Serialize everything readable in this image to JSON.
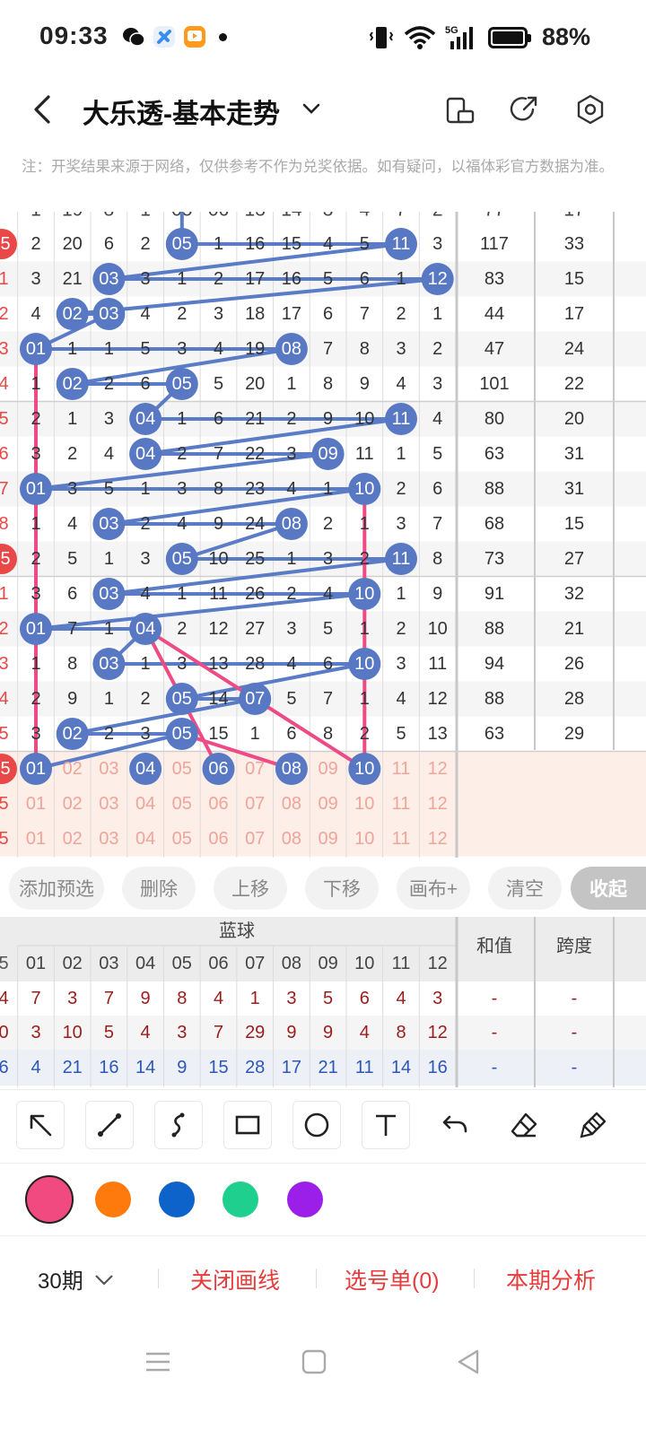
{
  "status_bar": {
    "time": "09:33",
    "battery": "88%",
    "network": "5G"
  },
  "header": {
    "title": "大乐透-基本走势"
  },
  "notice": "注：开奖结果来源于网络，仅供参考不作为兑奖依据。如有疑问，以福体彩官方数据为准。",
  "grid": {
    "partial_top_row": [
      "1",
      "19",
      "8",
      "1",
      "05",
      "06",
      "13",
      "14",
      "3",
      "4",
      "7",
      "2",
      "77",
      "17"
    ],
    "left_edge_numbers": [
      "5",
      "1",
      "2",
      "3",
      "4",
      "5",
      "6",
      "7",
      "8",
      "5",
      "1",
      "2",
      "3",
      "4",
      "5",
      "5",
      "5",
      "5"
    ],
    "rows": [
      {
        "cells": [
          "2",
          "20",
          "6",
          "2",
          "05",
          "1",
          "16",
          "15",
          "4",
          "5",
          "11",
          "3"
        ],
        "hit": [
          4,
          10
        ],
        "sum": "117",
        "span": "33"
      },
      {
        "cells": [
          "3",
          "21",
          "03",
          "3",
          "1",
          "2",
          "17",
          "16",
          "5",
          "6",
          "1",
          "12"
        ],
        "hit": [
          2,
          11
        ],
        "sum": "83",
        "span": "15"
      },
      {
        "cells": [
          "4",
          "02",
          "03",
          "4",
          "2",
          "3",
          "18",
          "17",
          "6",
          "7",
          "2",
          "1"
        ],
        "hit": [
          1,
          2
        ],
        "sum": "44",
        "span": "17"
      },
      {
        "cells": [
          "01",
          "1",
          "1",
          "5",
          "3",
          "4",
          "19",
          "08",
          "7",
          "8",
          "3",
          "2"
        ],
        "hit": [
          0,
          7
        ],
        "sum": "47",
        "span": "24"
      },
      {
        "cells": [
          "1",
          "02",
          "2",
          "6",
          "05",
          "5",
          "20",
          "1",
          "8",
          "9",
          "4",
          "3"
        ],
        "hit": [
          1,
          4
        ],
        "sum": "101",
        "span": "22"
      },
      {
        "cells": [
          "2",
          "1",
          "3",
          "04",
          "1",
          "6",
          "21",
          "2",
          "9",
          "10",
          "11",
          "4"
        ],
        "hit": [
          3,
          10
        ],
        "sum": "80",
        "span": "20"
      },
      {
        "cells": [
          "3",
          "2",
          "4",
          "04",
          "2",
          "7",
          "22",
          "3",
          "09",
          "11",
          "1",
          "5"
        ],
        "hit": [
          3,
          8
        ],
        "sum": "63",
        "span": "31"
      },
      {
        "cells": [
          "01",
          "3",
          "5",
          "1",
          "3",
          "8",
          "23",
          "4",
          "1",
          "10",
          "2",
          "6"
        ],
        "hit": [
          0,
          9
        ],
        "sum": "88",
        "span": "31"
      },
      {
        "cells": [
          "1",
          "4",
          "03",
          "2",
          "4",
          "9",
          "24",
          "08",
          "2",
          "1",
          "3",
          "7"
        ],
        "hit": [
          2,
          7
        ],
        "sum": "68",
        "span": "15"
      },
      {
        "cells": [
          "2",
          "5",
          "1",
          "3",
          "05",
          "10",
          "25",
          "1",
          "3",
          "2",
          "11",
          "8"
        ],
        "hit": [
          4,
          10
        ],
        "sum": "73",
        "span": "27"
      },
      {
        "cells": [
          "3",
          "6",
          "03",
          "4",
          "1",
          "11",
          "26",
          "2",
          "4",
          "10",
          "1",
          "9"
        ],
        "hit": [
          2,
          9
        ],
        "sum": "91",
        "span": "32"
      },
      {
        "cells": [
          "01",
          "7",
          "1",
          "04",
          "2",
          "12",
          "27",
          "3",
          "5",
          "1",
          "2",
          "10"
        ],
        "hit": [
          0,
          3
        ],
        "sum": "88",
        "span": "21"
      },
      {
        "cells": [
          "1",
          "8",
          "03",
          "1",
          "3",
          "13",
          "28",
          "4",
          "6",
          "10",
          "3",
          "11"
        ],
        "hit": [
          2,
          9
        ],
        "sum": "94",
        "span": "26"
      },
      {
        "cells": [
          "2",
          "9",
          "1",
          "2",
          "05",
          "14",
          "07",
          "5",
          "7",
          "1",
          "4",
          "12"
        ],
        "hit": [
          4,
          6
        ],
        "sum": "88",
        "span": "28"
      },
      {
        "cells": [
          "3",
          "02",
          "2",
          "3",
          "05",
          "15",
          "1",
          "6",
          "8",
          "2",
          "5",
          "13"
        ],
        "hit": [
          1,
          4
        ],
        "sum": "63",
        "span": "29"
      }
    ],
    "preselect_rows": [
      {
        "cells": [
          "01",
          "02",
          "03",
          "04",
          "05",
          "06",
          "07",
          "08",
          "09",
          "10",
          "11",
          "12"
        ],
        "hit": [
          0,
          3,
          5,
          7,
          9
        ]
      },
      {
        "cells": [
          "01",
          "02",
          "03",
          "04",
          "05",
          "06",
          "07",
          "08",
          "09",
          "10",
          "11",
          "12"
        ],
        "hit": []
      },
      {
        "cells": [
          "01",
          "02",
          "03",
          "04",
          "05",
          "06",
          "07",
          "08",
          "09",
          "10",
          "11",
          "12"
        ],
        "hit": []
      }
    ]
  },
  "toolbar": {
    "buttons": [
      "添加预选",
      "删除",
      "上移",
      "下移",
      "画布+",
      "清空"
    ],
    "collapse": "收起"
  },
  "blue_table": {
    "group_label": "蓝球",
    "sum_label": "和值",
    "span_label": "跨度",
    "columns": [
      "01",
      "02",
      "03",
      "04",
      "05",
      "06",
      "07",
      "08",
      "09",
      "10",
      "11",
      "12"
    ],
    "left_col": [
      "5",
      "4",
      "0",
      "6"
    ],
    "stats_rows": [
      {
        "values": [
          "7",
          "3",
          "7",
          "9",
          "8",
          "4",
          "1",
          "3",
          "5",
          "6",
          "4",
          "3"
        ],
        "sum": "-",
        "span": "-",
        "color": "#9c1c1c"
      },
      {
        "values": [
          "3",
          "10",
          "5",
          "4",
          "3",
          "7",
          "29",
          "9",
          "9",
          "4",
          "8",
          "12"
        ],
        "sum": "-",
        "span": "-",
        "color": "#9c1c1c"
      },
      {
        "values": [
          "4",
          "21",
          "16",
          "14",
          "9",
          "15",
          "28",
          "17",
          "21",
          "11",
          "14",
          "16"
        ],
        "sum": "-",
        "span": "-",
        "color": "#2a57b8"
      }
    ]
  },
  "draw_tools": [
    "arrow-tool-icon",
    "line-tool-icon",
    "curve-tool-icon",
    "rect-tool-icon",
    "circle-tool-icon",
    "text-tool-icon",
    "undo-icon",
    "eraser-icon",
    "clear-brush-icon"
  ],
  "colors": {
    "swatches": [
      "#f04a80",
      "#ff7a0d",
      "#0d63c9",
      "#1ecf8e",
      "#9b1fe8"
    ],
    "selected": 0,
    "accent": "#e53c3c",
    "ball": "#5878c4",
    "line_blue": "#5a7bc6",
    "line_pink": "#ee4a86"
  },
  "bottom_bar": {
    "period": "30期",
    "close_lines": "关闭画线",
    "selection": "选号单(0)",
    "analysis": "本期分析"
  }
}
